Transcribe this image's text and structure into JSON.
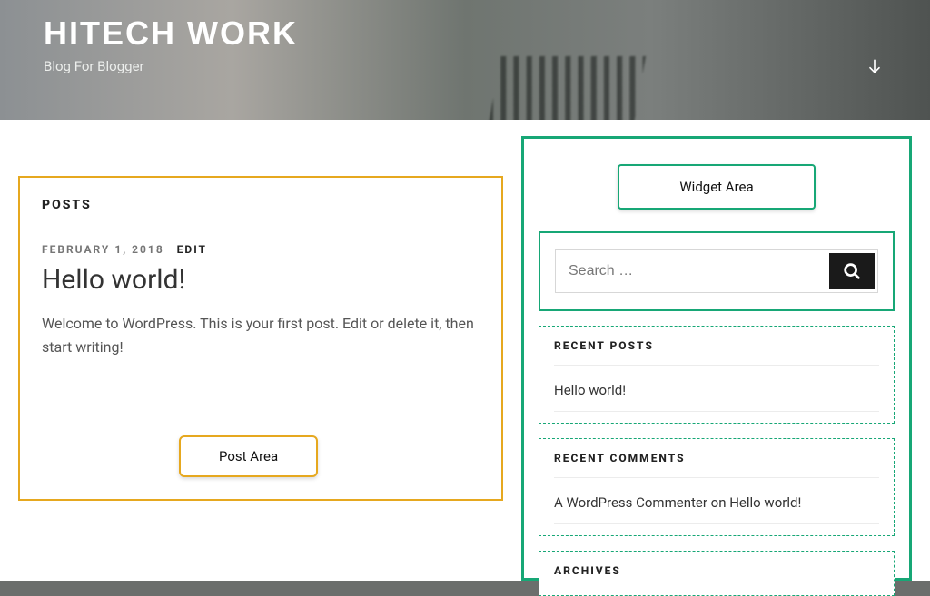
{
  "header": {
    "site_title": "HITECH WORK",
    "tagline": "Blog For Blogger"
  },
  "annotations": {
    "post_area_label": "Post Area",
    "widget_area_label": "Widget Area"
  },
  "main": {
    "posts_heading": "POSTS",
    "post": {
      "date": "FEBRUARY 1, 2018",
      "edit_label": "EDIT",
      "title": "Hello world!",
      "excerpt": "Welcome to WordPress. This is your first post. Edit or delete it, then start writing!"
    }
  },
  "sidebar": {
    "search": {
      "placeholder": "Search …"
    },
    "recent_posts": {
      "heading": "RECENT POSTS",
      "items": [
        "Hello world!"
      ]
    },
    "recent_comments": {
      "heading": "RECENT COMMENTS",
      "commenter": "A WordPress Commenter",
      "connector": " on ",
      "target": "Hello world!"
    },
    "archives": {
      "heading": "ARCHIVES"
    }
  }
}
